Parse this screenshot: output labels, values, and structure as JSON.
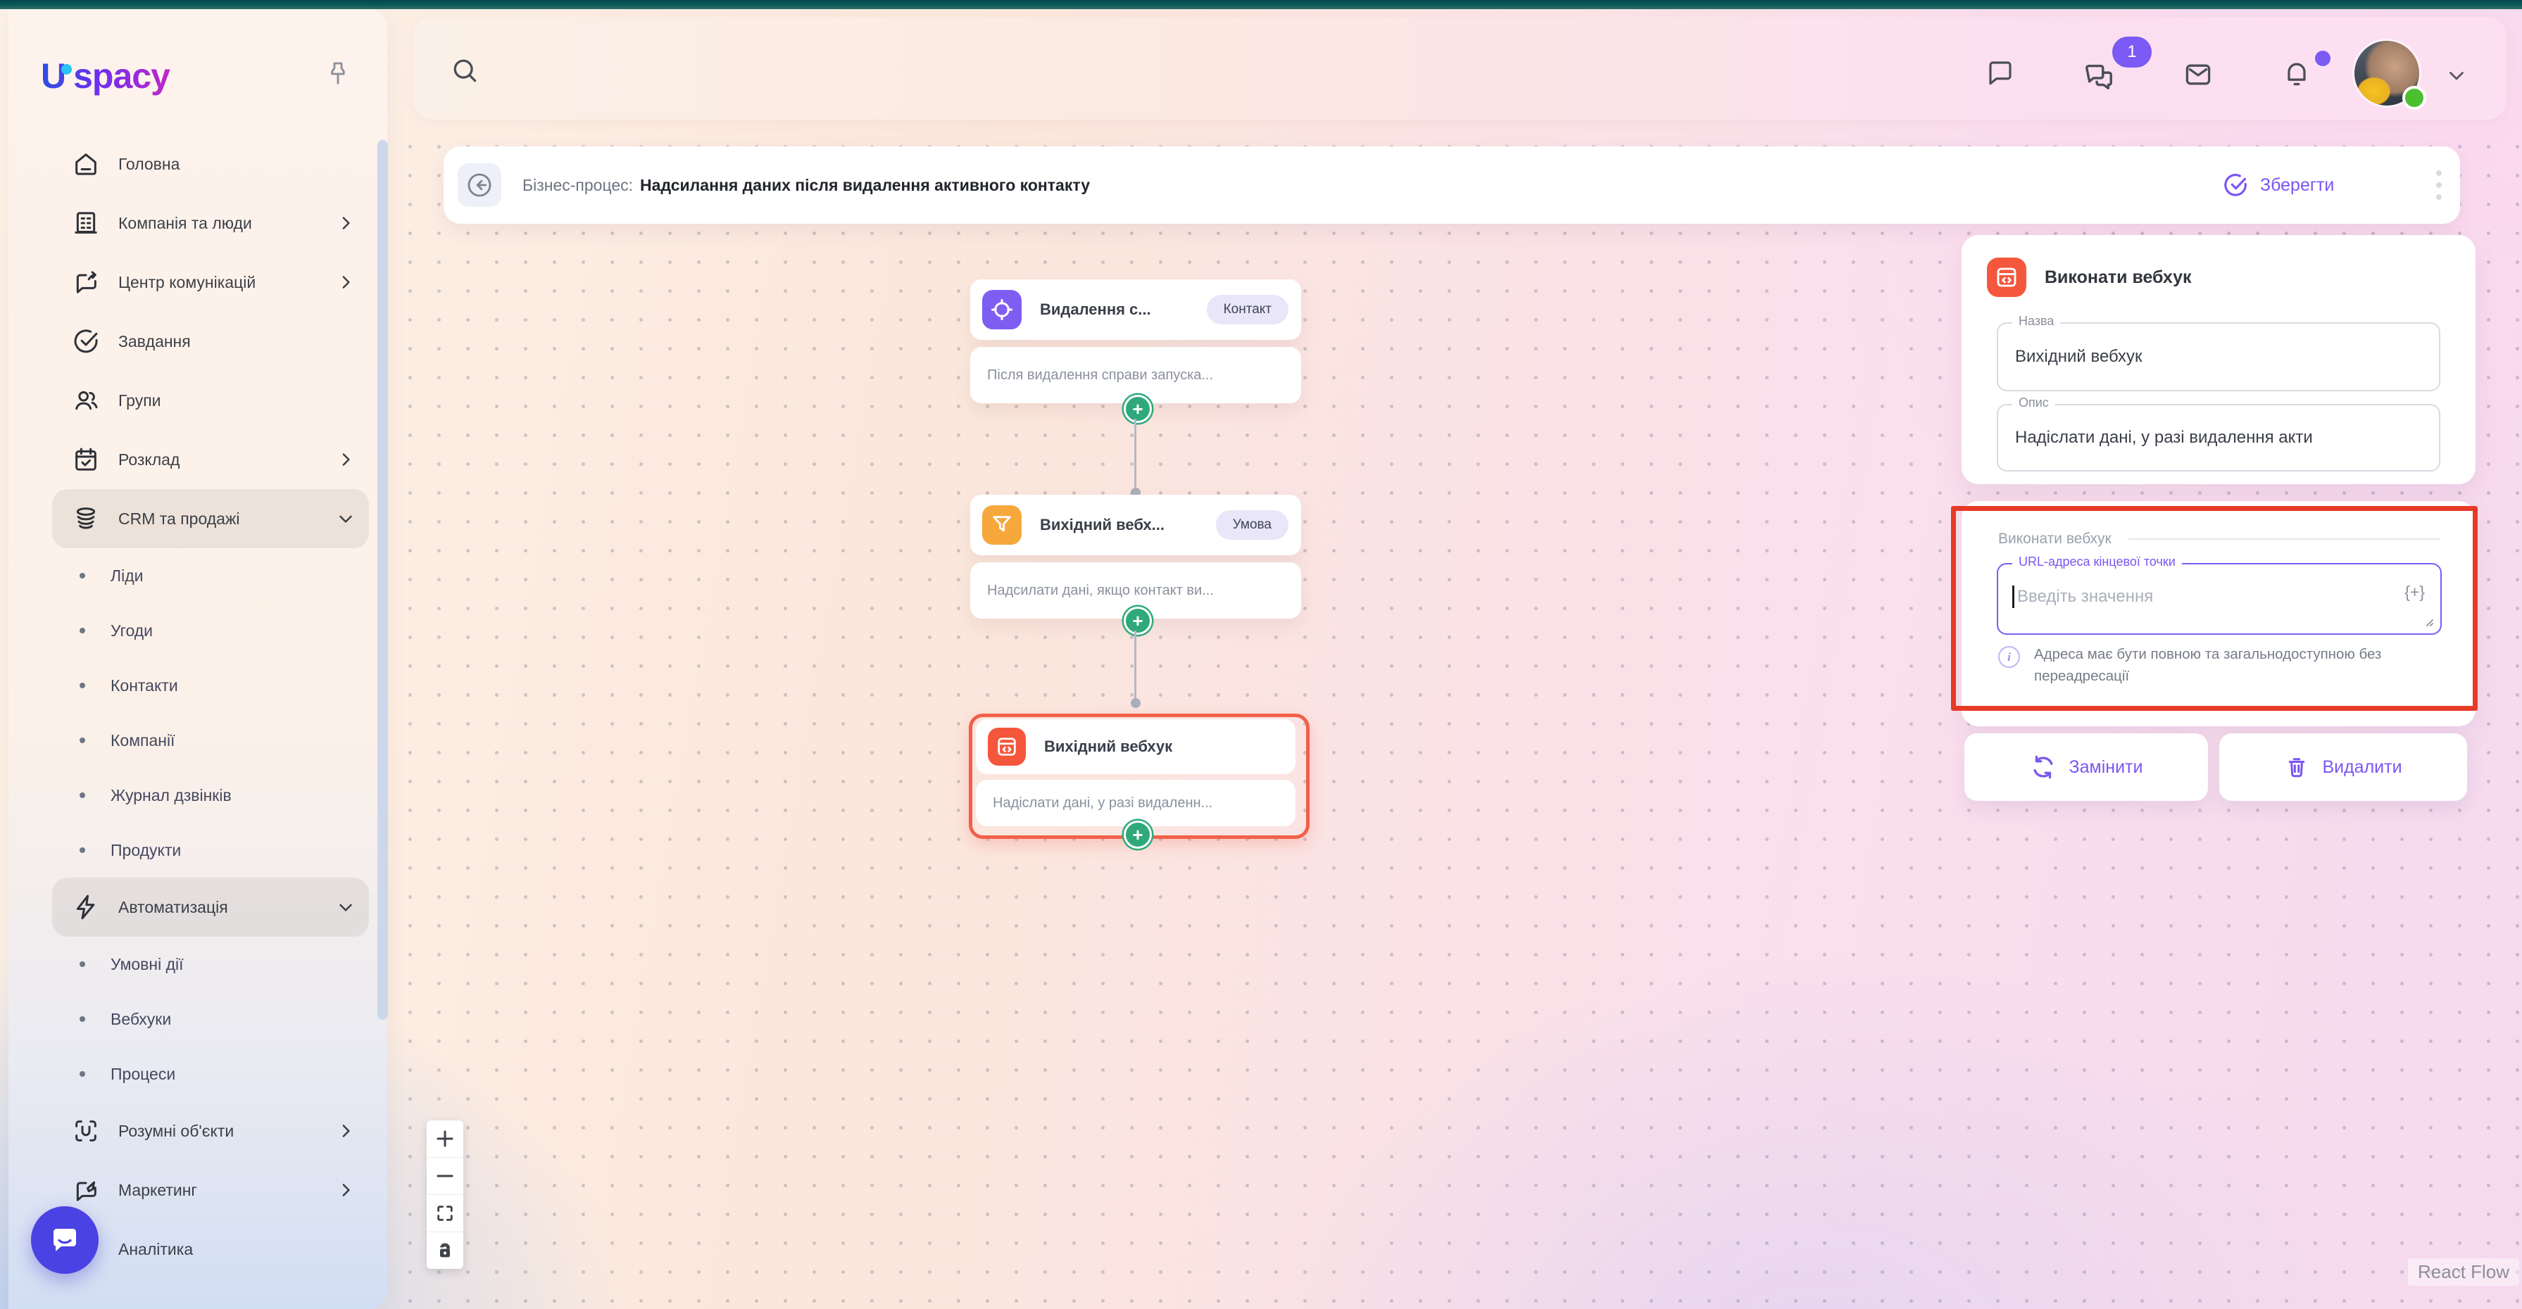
{
  "app": {
    "logo_u": "U",
    "logo_text": "spacy"
  },
  "topbar": {
    "chat_badge_count": "1"
  },
  "sidebar": {
    "items": [
      {
        "label": "Головна",
        "type": "main",
        "icon": "home"
      },
      {
        "label": "Компанія та люди",
        "type": "main",
        "icon": "company",
        "chevron": "right"
      },
      {
        "label": "Центр комунікацій",
        "type": "main",
        "icon": "comms",
        "chevron": "right"
      },
      {
        "label": "Завдання",
        "type": "main",
        "icon": "tasks"
      },
      {
        "label": "Групи",
        "type": "main",
        "icon": "groups"
      },
      {
        "label": "Розклад",
        "type": "main",
        "icon": "schedule",
        "chevron": "right"
      },
      {
        "label": "CRM та продажі",
        "type": "main",
        "icon": "crm",
        "chevron": "down",
        "active": true
      },
      {
        "label": "Ліди",
        "type": "sub"
      },
      {
        "label": "Угоди",
        "type": "sub"
      },
      {
        "label": "Контакти",
        "type": "sub"
      },
      {
        "label": "Компанії",
        "type": "sub"
      },
      {
        "label": "Журнал дзвінків",
        "type": "sub"
      },
      {
        "label": "Продукти",
        "type": "sub"
      },
      {
        "label": "Автоматизація",
        "type": "main",
        "icon": "automation",
        "chevron": "down",
        "active": true
      },
      {
        "label": "Умовні дії",
        "type": "sub"
      },
      {
        "label": "Вебхуки",
        "type": "sub"
      },
      {
        "label": "Процеси",
        "type": "sub"
      },
      {
        "label": "Розумні об'єкти",
        "type": "main",
        "icon": "smart-objects",
        "chevron": "right"
      },
      {
        "label": "Маркетинг",
        "type": "main",
        "icon": "marketing",
        "chevron": "right"
      },
      {
        "label": "Аналітика",
        "type": "main",
        "icon": "analytics"
      }
    ]
  },
  "header": {
    "prefix": "Бізнес-процес:",
    "title": "Надсилання даних після видалення активного контакту",
    "save_label": "Зберегти"
  },
  "flow": {
    "nodes": [
      {
        "title": "Видалення с...",
        "badge": "Контакт",
        "desc": "Після видалення справи запуска..."
      },
      {
        "title": "Вихідний вебх...",
        "badge": "Умова",
        "desc": "Надсилати дані, якщо контакт ви..."
      },
      {
        "title": "Вихідний вебхук",
        "badge": "",
        "desc": "Надіслати дані, у разі видаленн..."
      }
    ],
    "watermark": "React Flow"
  },
  "panel": {
    "title": "Виконати вебхук",
    "name_label": "Назва",
    "name_value": "Вихідний вебхук",
    "desc_label": "Опис",
    "desc_value": "Надіслати дані, у разі видалення акти",
    "section_label": "Виконати вебхук",
    "url_label": "URL-адреса кінцевої точки",
    "url_placeholder": "Введіть значення",
    "token_button": "{+}",
    "hint": "Адреса має бути повною та загальнодоступною без переадресації",
    "replace_button": "Замінити",
    "delete_button": "Видалити"
  },
  "colors": {
    "accent_purple": "#7A56F2",
    "node_trigger": "#7E5EF2",
    "node_condition": "#F6A83C",
    "node_webhook": "#F5573D",
    "selection_red": "#F2604A",
    "annotation_red": "#E63B25",
    "handle_green": "#2FA97C",
    "teal_top": "#0D5C59",
    "badge_bg": "#E8E6F8"
  }
}
